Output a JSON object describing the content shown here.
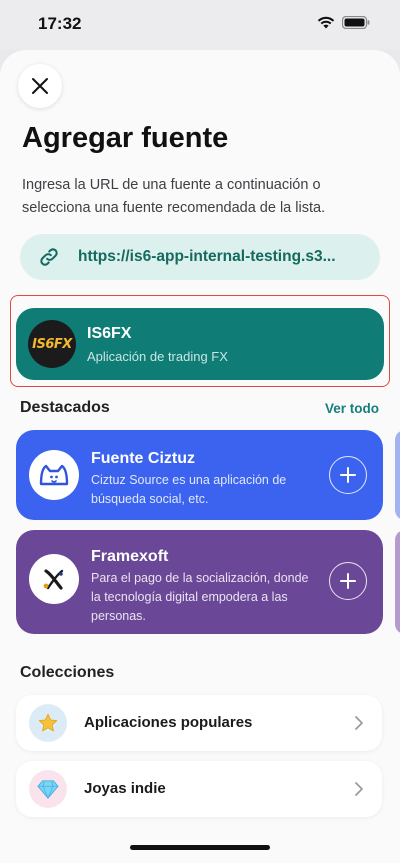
{
  "status": {
    "time": "17:32"
  },
  "page": {
    "title": "Agregar fuente",
    "subtitle": "Ingresa la URL de una fuente a continuación o selecciona una fuente recomendada de la lista."
  },
  "url_field": {
    "value": "https://is6-app-internal-testing.s3...",
    "icon": "link-icon"
  },
  "selected_source": {
    "logo_text": "IS6FX",
    "name": "IS6FX",
    "description": "Aplicación de trading FX",
    "color": "#0f7c76"
  },
  "featured": {
    "header": "Destacados",
    "see_all": "Ver todo",
    "items": [
      {
        "name": "Fuente Ciztuz",
        "description": "Ciztuz Source es una aplicación de búsqueda social, etc.",
        "color": "#3b63f0",
        "icon": "ciztuz-logo-icon"
      },
      {
        "name": "Framexoft",
        "description": "Para el pago de la socialización, donde la tecnología digital empodera a las personas.",
        "color": "#6b4897",
        "icon": "framexoft-logo-icon"
      }
    ]
  },
  "collections": {
    "header": "Colecciones",
    "items": [
      {
        "label": "Aplicaciones populares",
        "icon": "star-icon",
        "icon_bg": "#dcecf7"
      },
      {
        "label": "Joyas indie",
        "icon": "diamond-icon",
        "icon_bg": "#fbe3ee"
      }
    ]
  }
}
